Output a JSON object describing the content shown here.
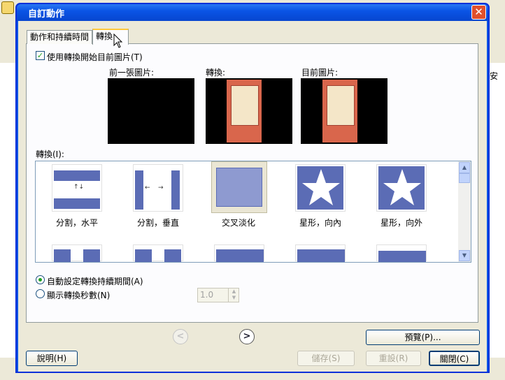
{
  "background": {
    "side_char": "安"
  },
  "dialog": {
    "title": "自訂動作",
    "close_glyph": "✕",
    "tabs": [
      {
        "label": "動作和持續時間"
      },
      {
        "label": "轉換"
      }
    ],
    "use_transition_label": "使用轉換開始目前圖片(T)",
    "preview_labels": {
      "previous": "前一張圖片:",
      "transition": "轉換:",
      "current": "目前圖片:"
    },
    "transitions_label": "轉換(I):",
    "transitions": [
      {
        "label": "分割，水平"
      },
      {
        "label": "分割，垂直"
      },
      {
        "label": "交叉淡化"
      },
      {
        "label": "星形，向內"
      },
      {
        "label": "星形，向外"
      }
    ],
    "auto_duration_label": "自動設定轉換持續期間(A)",
    "show_seconds_label": "顯示轉換秒數(N)",
    "seconds_value": "1.0",
    "buttons": {
      "preview": "預覽(P)...",
      "help": "說明(H)",
      "save": "儲存(S)",
      "reset": "重設(R)",
      "close": "關閉(C)"
    },
    "nav": {
      "prev": "<",
      "next": ">"
    }
  }
}
